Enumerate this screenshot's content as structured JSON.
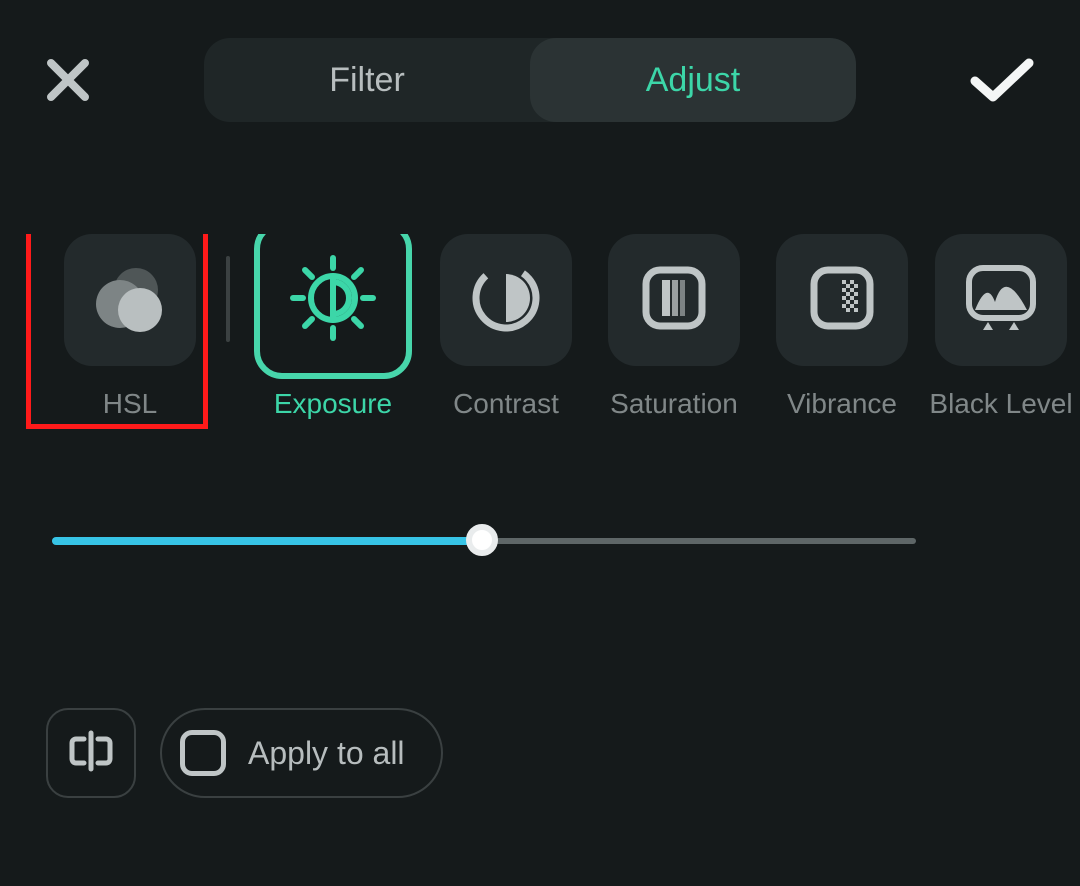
{
  "header": {
    "tabs": [
      {
        "label": "Filter",
        "active": false
      },
      {
        "label": "Adjust",
        "active": true
      }
    ]
  },
  "tools": [
    {
      "id": "hsl",
      "label": "HSL",
      "selected": false,
      "highlighted": true
    },
    {
      "id": "exposure",
      "label": "Exposure",
      "selected": true
    },
    {
      "id": "contrast",
      "label": "Contrast",
      "selected": false
    },
    {
      "id": "saturation",
      "label": "Saturation",
      "selected": false
    },
    {
      "id": "vibrance",
      "label": "Vibrance",
      "selected": false
    },
    {
      "id": "blacklevel",
      "label": "Black Level",
      "selected": false
    }
  ],
  "slider": {
    "value": 50,
    "min": 0,
    "max": 100
  },
  "bottom": {
    "apply_all_label": "Apply to all"
  },
  "colors": {
    "accent": "#3cd6a8",
    "slider": "#37c4e6",
    "highlight": "#ff1a1a"
  }
}
